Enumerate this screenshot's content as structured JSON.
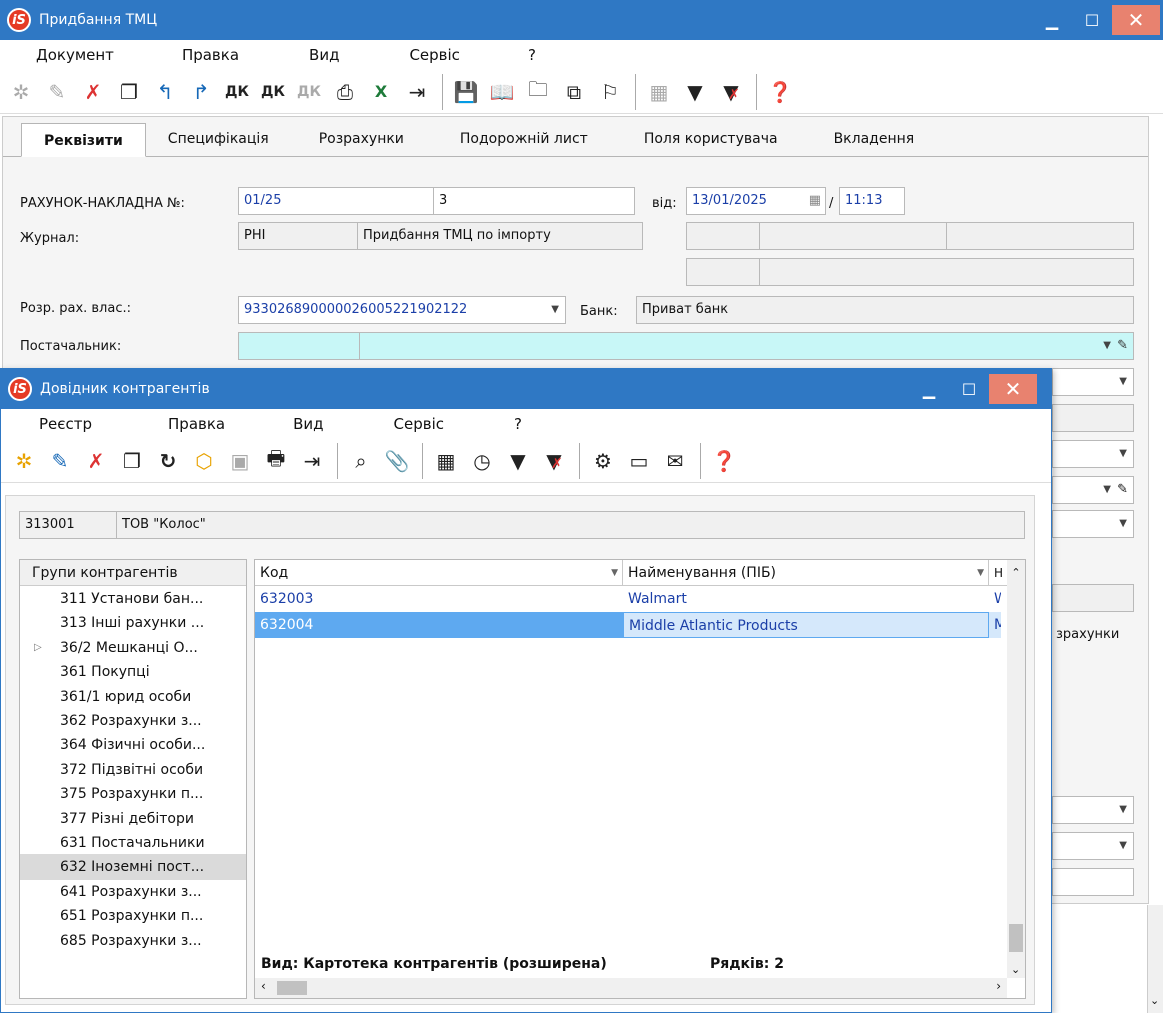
{
  "main_window": {
    "title": "Придбання ТМЦ",
    "menu": [
      "Документ",
      "Правка",
      "Вид",
      "Сервіс",
      "?"
    ],
    "tabs": [
      "Реквізити",
      "Специфікація",
      "Розрахунки",
      "Подорожній лист",
      "Поля користувача",
      "Вкладення"
    ],
    "form": {
      "invoice_label": "РАХУНОК-НАКЛАДНА №:",
      "invoice_number": "01/25",
      "invoice_extra": "3",
      "date_label": "від:",
      "date": "13/01/2025",
      "time_sep": "/",
      "time": "11:13",
      "journal_label": "Журнал:",
      "journal_code": "PHI",
      "journal_name": "Придбання ТМЦ по імпорту",
      "account_label": "Розр. рах. влас.:",
      "account_value": "933026890000026005221902122",
      "bank_label": "Банк:",
      "bank_value": "Приват банк",
      "supplier_label": "Постачальник:",
      "side_text": "зрахунки"
    }
  },
  "lookup_window": {
    "title": "Довідник контрагентів",
    "menu": [
      "Реєстр",
      "Правка",
      "Вид",
      "Сервіс",
      "?"
    ],
    "current_code": "313001",
    "current_name": "ТОВ \"Колос\"",
    "groups_header": "Групи контрагентів",
    "groups": [
      "311 Установи бан...",
      "313 Інші рахунки ...",
      "36/2 Мешканці О...",
      "361 Покупці",
      "361/1 юрид особи",
      "362 Розрахунки з...",
      "364 Фізичні особи...",
      "372 Підзвітні особи",
      "375 Розрахунки п...",
      "377 Різні дебітори",
      "631 Постачальники",
      "632 Іноземні пост...",
      "641 Розрахунки з...",
      "651 Розрахунки п...",
      "685 Розрахунки з..."
    ],
    "selected_group_index": 11,
    "columns": [
      "Код",
      "Найменування (ПІБ)",
      "Н"
    ],
    "rows": [
      {
        "code": "632003",
        "name": "Walmart",
        "extra": "W"
      },
      {
        "code": "632004",
        "name": "Middle Atlantic Products",
        "extra": "M"
      }
    ],
    "footer_view": "Вид: Картотека контрагентів (розширена)",
    "footer_rows": "Рядків: 2"
  },
  "colors": {
    "titlebar": "#2f78c4",
    "close_button": "#e8826f",
    "selection_row": "#5ea9f0",
    "supplier_field": "#c8f7f7"
  }
}
